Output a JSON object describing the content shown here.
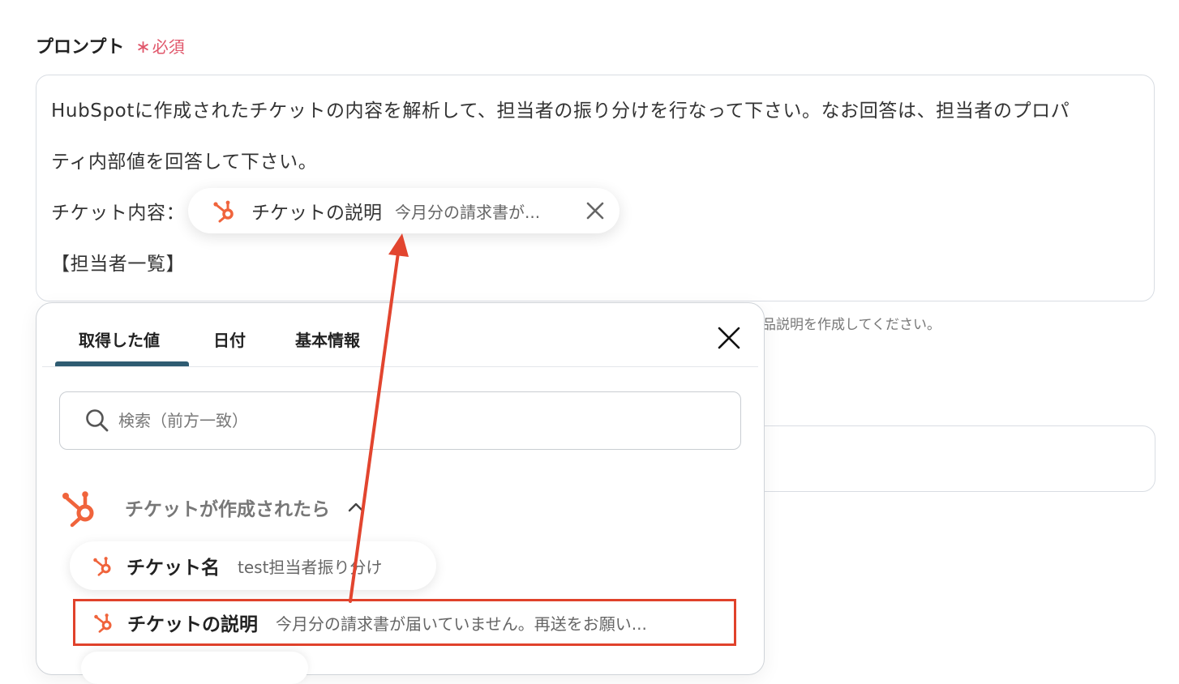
{
  "field": {
    "label": "プロンプト",
    "required_star": "∗",
    "required_text": "必須"
  },
  "prompt": {
    "line1": "HubSpotに作成されたチケットの内容を解析して、担当者の振り分けを行なって下さい。なお回答は、担当者のプロパ",
    "line2": "ティ内部値を回答して下さい。",
    "line3_prefix": "チケット内容：",
    "line4": "【担当者一覧】",
    "chip": {
      "label": "チケットの説明",
      "value": "今月分の請求書が..."
    }
  },
  "helper_text": "品説明を作成してください。",
  "popup": {
    "tabs": [
      "取得した値",
      "日付",
      "基本情報"
    ],
    "active_tab": 0,
    "search_placeholder": "検索（前方一致）",
    "group": {
      "title": "チケットが作成されたら",
      "items": [
        {
          "label": "チケット名",
          "value": "test担当者振り分け"
        },
        {
          "label": "チケットの説明",
          "value": "今月分の請求書が届いていません。再送をお願い..."
        }
      ]
    }
  },
  "colors": {
    "hubspot_orange": "#f0643c",
    "required_red": "#e0566a",
    "tab_underline": "#2f5c72",
    "highlight_border": "#e0422b",
    "arrow": "#e2452f"
  },
  "icons": {
    "chip": "hubspot-icon",
    "chip_close": "close-icon",
    "popup_close": "close-icon",
    "search": "search-icon",
    "group": "hubspot-icon",
    "group_toggle": "chevron-up-icon"
  }
}
